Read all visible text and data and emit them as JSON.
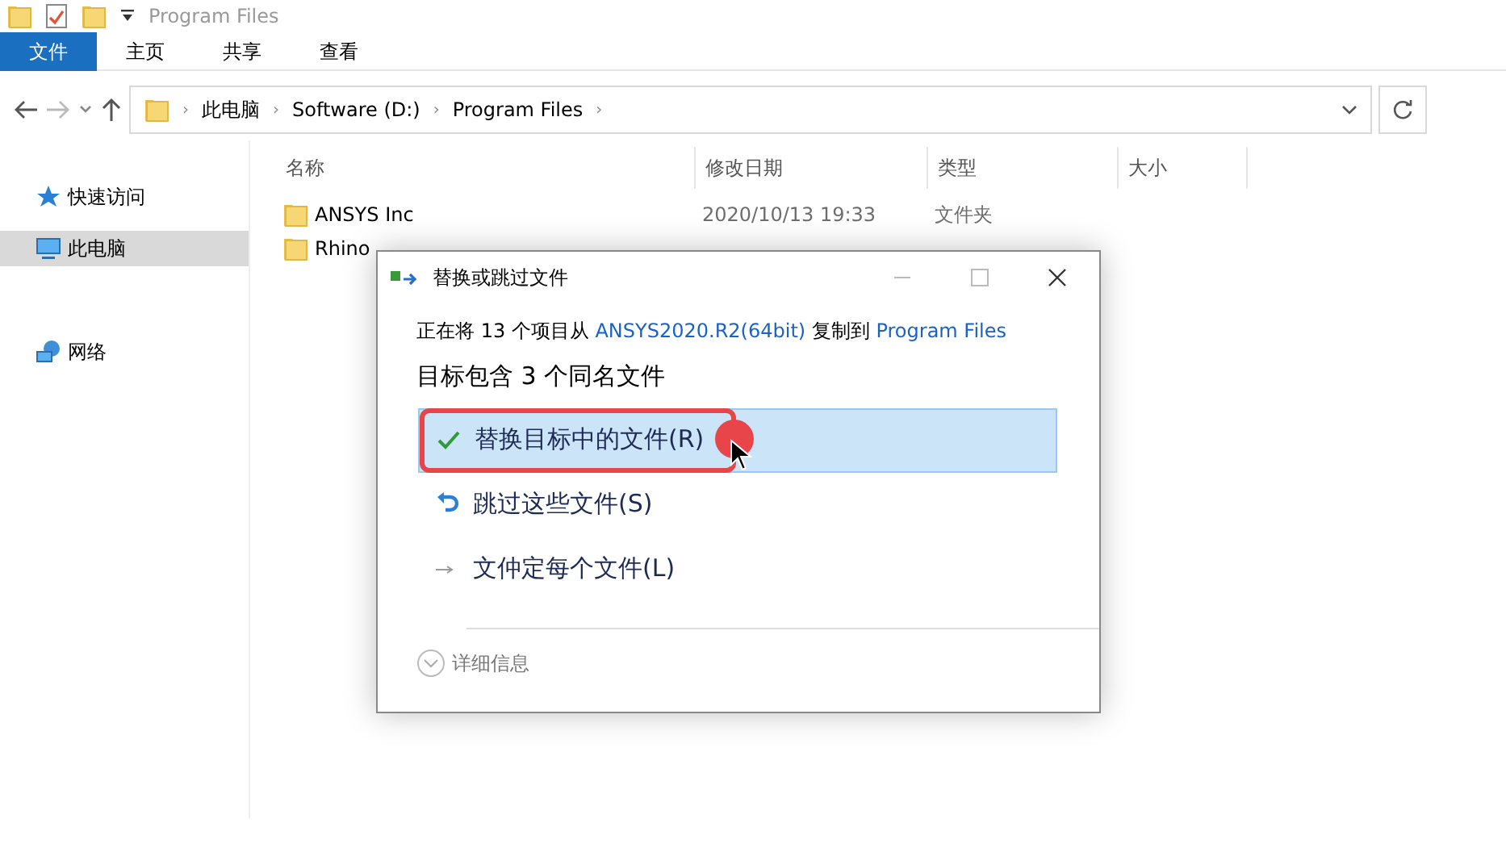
{
  "title_bar": {
    "title": "Program Files"
  },
  "ribbon_tabs": [
    {
      "label": "文件",
      "selected": true
    },
    {
      "label": "主页",
      "selected": false
    },
    {
      "label": "共享",
      "selected": false
    },
    {
      "label": "查看",
      "selected": false
    }
  ],
  "address_bar": {
    "path": [
      "此电脑",
      "Software (D:)",
      "Program Files"
    ],
    "separator": "›"
  },
  "sidebar": {
    "items": [
      {
        "label": "快速访问",
        "kind": "star",
        "selected": false
      },
      {
        "label": "此电脑",
        "kind": "pc",
        "selected": true
      },
      {
        "label": "网络",
        "kind": "network",
        "selected": false
      }
    ]
  },
  "table": {
    "columns": [
      "名称",
      "修改日期",
      "类型",
      "大小"
    ],
    "rows": [
      {
        "name": "ANSYS Inc",
        "date": "2020/10/13 19:33",
        "type": "文件夹"
      },
      {
        "name": "Rhino"
      }
    ]
  },
  "dialog": {
    "title": "替换或跳过文件",
    "message": [
      "正在将 13 个项目从 ",
      "ANSYS2020.R2(64bit)",
      " 复制到 ",
      "Program Files"
    ],
    "heading": "目标包含 3 个同名文件",
    "options": [
      {
        "kind": "replace",
        "label": "替换目标中的文件(R)",
        "selected": true
      },
      {
        "kind": "skip",
        "label": "跳过这些文件(S)",
        "selected": false
      },
      {
        "kind": "decide",
        "label": "文仲定每个文件(L)",
        "selected": false
      }
    ],
    "details": "详细信息"
  }
}
